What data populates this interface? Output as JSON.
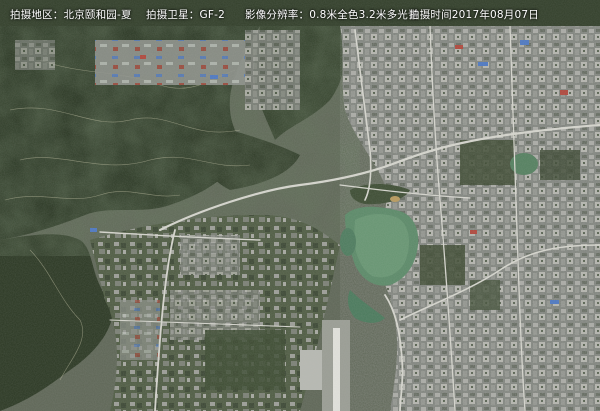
{
  "caption": {
    "area": "拍摄地区：北京颐和园-夏",
    "satellite": "拍摄卫星：GF-2",
    "resolution": "影像分辨率：0.8米全色3.2米多光谱",
    "time": "拍摄时间2017年08月07日"
  },
  "colors": {
    "forest_dark": "#1f2a1a",
    "forest_mid": "#2e3c24",
    "urban_gray": "#8a8d88",
    "urban_light": "#b9bab4",
    "lake": "#4f7a62",
    "road": "#d8d8d0"
  }
}
